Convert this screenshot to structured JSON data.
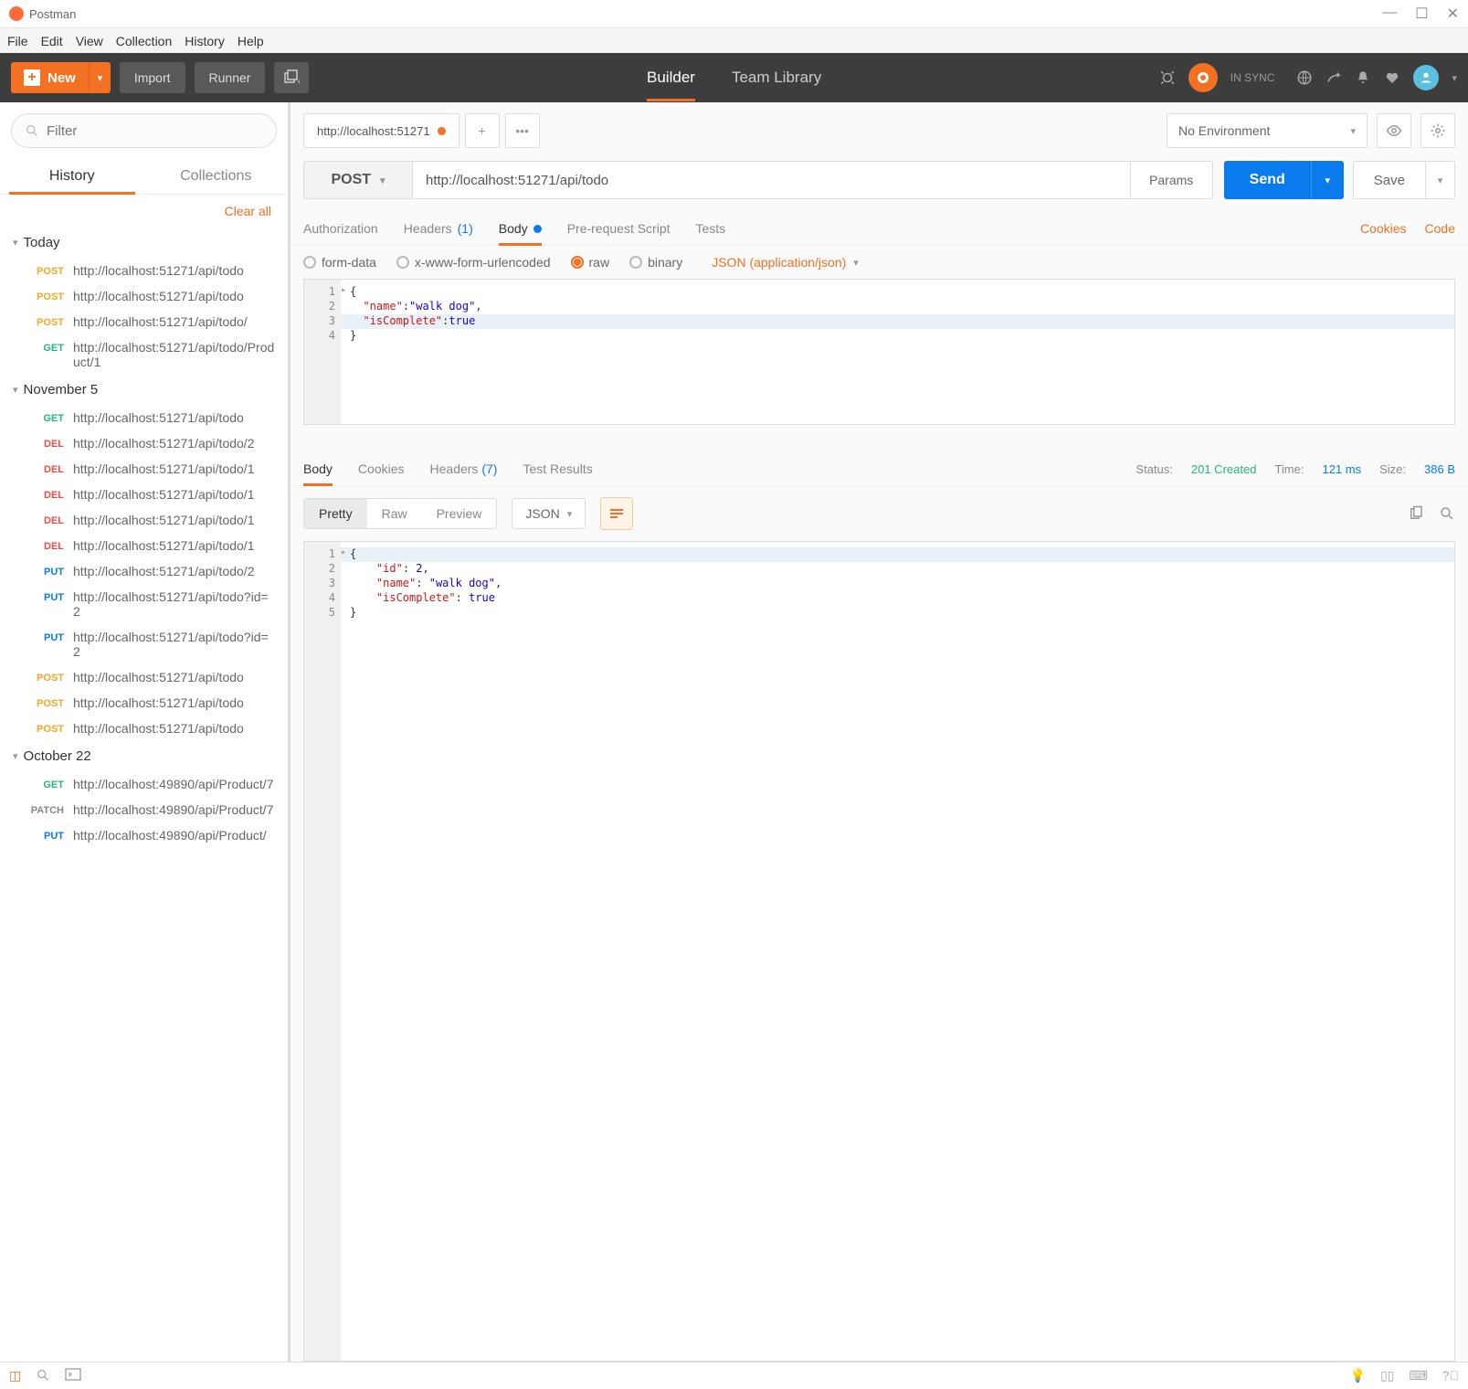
{
  "window": {
    "title": "Postman"
  },
  "menu": [
    "File",
    "Edit",
    "View",
    "Collection",
    "History",
    "Help"
  ],
  "topbar": {
    "new_label": "New",
    "import_label": "Import",
    "runner_label": "Runner",
    "center_tabs": [
      "Builder",
      "Team Library"
    ],
    "active_center": 0,
    "sync_label": "IN SYNC"
  },
  "sidebar": {
    "filter_placeholder": "Filter",
    "tabs": [
      "History",
      "Collections"
    ],
    "active_tab": 0,
    "clear_all": "Clear all",
    "groups": [
      {
        "label": "Today",
        "items": [
          {
            "method": "POST",
            "url": "http://localhost:51271/api/todo"
          },
          {
            "method": "POST",
            "url": "http://localhost:51271/api/todo"
          },
          {
            "method": "POST",
            "url": "http://localhost:51271/api/todo/"
          },
          {
            "method": "GET",
            "url": "http://localhost:51271/api/todo/Product/1"
          }
        ]
      },
      {
        "label": "November 5",
        "items": [
          {
            "method": "GET",
            "url": "http://localhost:51271/api/todo"
          },
          {
            "method": "DEL",
            "url": "http://localhost:51271/api/todo/2"
          },
          {
            "method": "DEL",
            "url": "http://localhost:51271/api/todo/1"
          },
          {
            "method": "DEL",
            "url": "http://localhost:51271/api/todo/1"
          },
          {
            "method": "DEL",
            "url": "http://localhost:51271/api/todo/1"
          },
          {
            "method": "DEL",
            "url": "http://localhost:51271/api/todo/1"
          },
          {
            "method": "PUT",
            "url": "http://localhost:51271/api/todo/2"
          },
          {
            "method": "PUT",
            "url": "http://localhost:51271/api/todo?id=2"
          },
          {
            "method": "PUT",
            "url": "http://localhost:51271/api/todo?id=2"
          },
          {
            "method": "POST",
            "url": "http://localhost:51271/api/todo"
          },
          {
            "method": "POST",
            "url": "http://localhost:51271/api/todo"
          },
          {
            "method": "POST",
            "url": "http://localhost:51271/api/todo"
          }
        ]
      },
      {
        "label": "October 22",
        "items": [
          {
            "method": "GET",
            "url": "http://localhost:49890/api/Product/7"
          },
          {
            "method": "PATCH",
            "url": "http://localhost:49890/api/Product/7"
          },
          {
            "method": "PUT",
            "url": "http://localhost:49890/api/Product/"
          }
        ]
      }
    ]
  },
  "request": {
    "tab_title": "http://localhost:51271",
    "environment": "No Environment",
    "method": "POST",
    "url": "http://localhost:51271/api/todo",
    "params_label": "Params",
    "send_label": "Send",
    "save_label": "Save",
    "tabs": [
      {
        "label": "Authorization"
      },
      {
        "label": "Headers",
        "count": "(1)"
      },
      {
        "label": "Body",
        "dot": true,
        "active": true
      },
      {
        "label": "Pre-request Script"
      },
      {
        "label": "Tests"
      }
    ],
    "tabs_right": [
      "Cookies",
      "Code"
    ],
    "body_types": [
      "form-data",
      "x-www-form-urlencoded",
      "raw",
      "binary"
    ],
    "body_type_selected": 2,
    "content_type": "JSON (application/json)",
    "body_lines": [
      {
        "n": 1,
        "text": "{",
        "arrow": true
      },
      {
        "n": 2,
        "tokens": [
          [
            "p",
            "  "
          ],
          [
            "k",
            "\"name\""
          ],
          [
            "p",
            ":"
          ],
          [
            "s",
            "\"walk dog\""
          ],
          [
            "p",
            ","
          ]
        ]
      },
      {
        "n": 3,
        "hl": true,
        "tokens": [
          [
            "p",
            "  "
          ],
          [
            "k",
            "\"isComplete\""
          ],
          [
            "p",
            ":"
          ],
          [
            "l",
            "true"
          ]
        ]
      },
      {
        "n": 4,
        "text": "}"
      }
    ]
  },
  "response": {
    "tabs": [
      "Body",
      "Cookies",
      "Headers",
      "Test Results"
    ],
    "active_tab": 0,
    "headers_count": "(7)",
    "status_label": "Status:",
    "status_value": "201 Created",
    "time_label": "Time:",
    "time_value": "121 ms",
    "size_label": "Size:",
    "size_value": "386 B",
    "format_tabs": [
      "Pretty",
      "Raw",
      "Preview"
    ],
    "format_active": 0,
    "lang": "JSON",
    "body_lines": [
      {
        "n": 1,
        "text": "{",
        "arrow": true,
        "hl": true
      },
      {
        "n": 2,
        "tokens": [
          [
            "p",
            "    "
          ],
          [
            "k",
            "\"id\""
          ],
          [
            "p",
            ": "
          ],
          [
            "l",
            "2"
          ],
          [
            "p",
            ","
          ]
        ]
      },
      {
        "n": 3,
        "tokens": [
          [
            "p",
            "    "
          ],
          [
            "k",
            "\"name\""
          ],
          [
            "p",
            ": "
          ],
          [
            "s",
            "\"walk dog\""
          ],
          [
            "p",
            ","
          ]
        ]
      },
      {
        "n": 4,
        "tokens": [
          [
            "p",
            "    "
          ],
          [
            "k",
            "\"isComplete\""
          ],
          [
            "p",
            ": "
          ],
          [
            "l",
            "true"
          ]
        ]
      },
      {
        "n": 5,
        "text": "}"
      }
    ]
  }
}
